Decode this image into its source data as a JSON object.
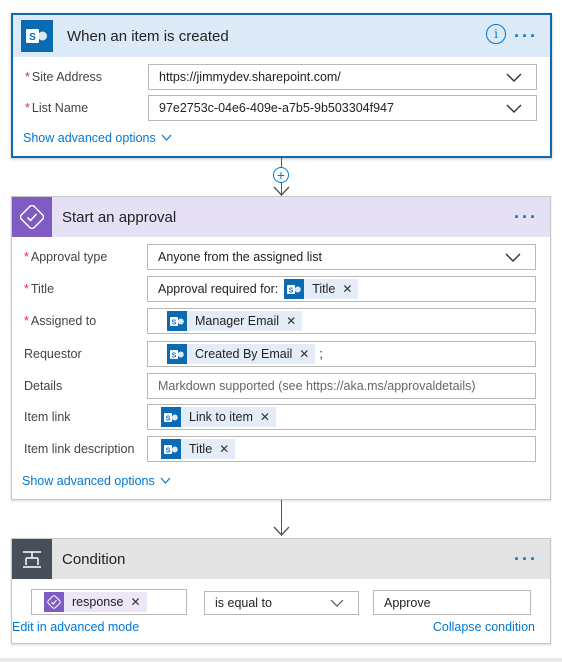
{
  "trigger": {
    "title": "When an item is created",
    "fields": [
      {
        "label": "Site Address",
        "required": true,
        "value": "https://jimmydev.sharepoint.com/"
      },
      {
        "label": "List Name",
        "required": true,
        "value": "97e2753c-04e6-409e-a7b5-9b503304f947"
      }
    ],
    "advanced_link": "Show advanced options",
    "colors": {
      "header": "#dce9f7",
      "border": "#0a6ab4",
      "icon": "#0a6ab4"
    }
  },
  "approval": {
    "title": "Start an approval",
    "approval_type": {
      "label": "Approval type",
      "value": "Anyone from the assigned list"
    },
    "title_field": {
      "label": "Title",
      "prefix": "Approval required for:",
      "token": "Title"
    },
    "assigned_to": {
      "label": "Assigned to",
      "token": "Manager Email"
    },
    "requestor": {
      "label": "Requestor",
      "token": "Created By Email",
      "suffix": ";"
    },
    "details": {
      "label": "Details",
      "placeholder": "Markdown supported (see https://aka.ms/approvaldetails)"
    },
    "item_link": {
      "label": "Item link",
      "token": "Link to item"
    },
    "item_link_description": {
      "label": "Item link description",
      "token": "Title"
    },
    "advanced_link": "Show advanced options",
    "colors": {
      "header": "#e6e0f5",
      "icon": "#7e5cc4"
    }
  },
  "condition": {
    "title": "Condition",
    "left_token": "response",
    "operator": "is equal to",
    "right_value": "Approve",
    "edit_link": "Edit in advanced mode",
    "collapse_link": "Collapse condition",
    "colors": {
      "header": "#e4e4e4",
      "icon": "#484f58"
    }
  },
  "icons": [
    "sharepoint-icon",
    "approval-icon",
    "condition-icon",
    "add-step-icon",
    "chevron-down-icon",
    "info-icon",
    "more-icon",
    "close-icon"
  ]
}
